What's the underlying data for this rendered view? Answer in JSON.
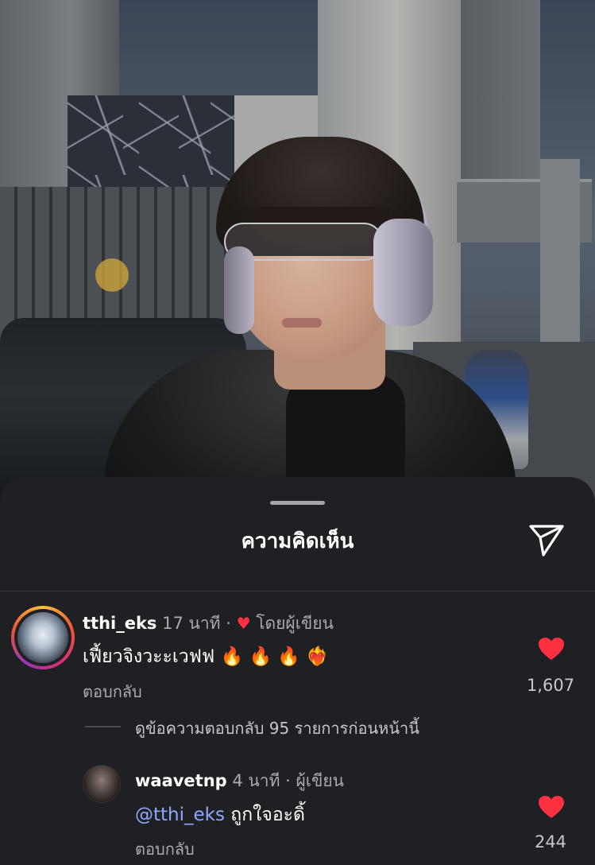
{
  "sheet": {
    "title": "ความคิดเห็น",
    "share_icon": "paper-plane-icon"
  },
  "comments": [
    {
      "username": "tthi_eks",
      "time": "17 นาที",
      "separator": "·",
      "liked_by_author_label": "โดยผู้เขียน",
      "text": "เฟี้ยวจิงวะะเวฟฟ",
      "emojis": "🔥 🔥 🔥 ❤️‍🔥",
      "reply_label": "ตอบกลับ",
      "like_count": "1,607",
      "liked": true
    }
  ],
  "view_replies_label": "ดูข้อความตอบกลับ 95 รายการก่อนหน้านี้",
  "reply": {
    "username": "waavetnp",
    "time": "4 นาที",
    "separator": "·",
    "author_label": "ผู้เขียน",
    "mention": "@tthi_eks",
    "text": "ถูกใจอะดิ้",
    "reply_label": "ตอบกลับ",
    "like_count": "244",
    "liked": true
  },
  "colors": {
    "sheet_bg": "#1f2024",
    "like_red": "#ff3040",
    "mention_blue": "#8fa8ff",
    "secondary_text": "#a8aab0"
  }
}
